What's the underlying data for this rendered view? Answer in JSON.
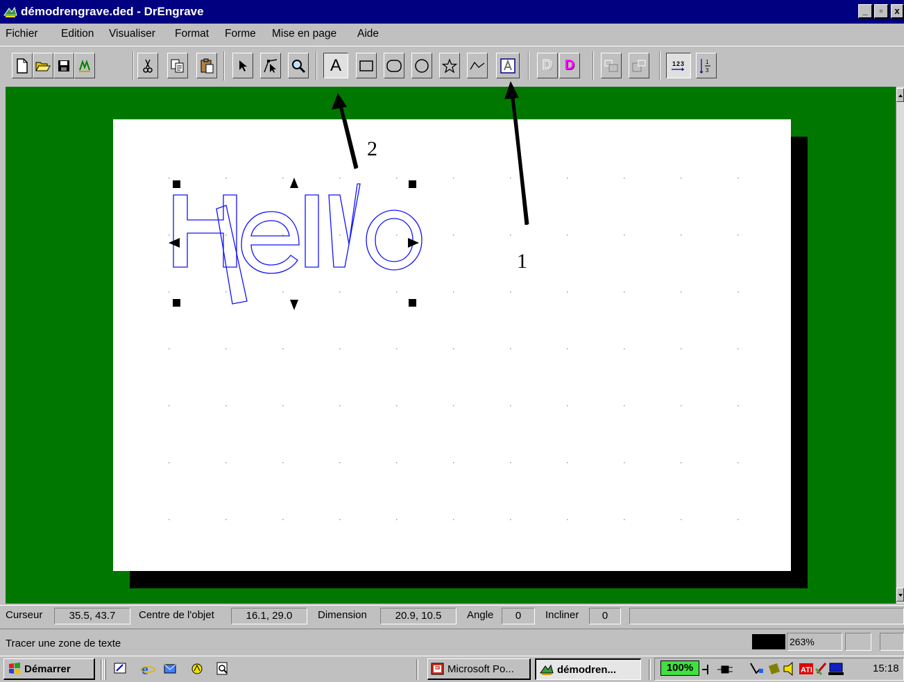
{
  "window": {
    "title": "démodrengrave.ded - DrEngrave",
    "app_icon": "drengrave-app-icon",
    "controls": {
      "minimize": "_",
      "maximize": "▫",
      "close": "x"
    }
  },
  "menu": {
    "items": [
      {
        "id": "fichier",
        "label": "Fichier"
      },
      {
        "id": "edition",
        "label": "Edition"
      },
      {
        "id": "visualiser",
        "label": "Visualiser"
      },
      {
        "id": "format",
        "label": "Format"
      },
      {
        "id": "forme",
        "label": "Forme"
      },
      {
        "id": "mise-en-page",
        "label": "Mise en page"
      },
      {
        "id": "aide",
        "label": "Aide"
      }
    ]
  },
  "toolbar": {
    "buttons": [
      {
        "name": "new-document",
        "icon": "new-document-icon"
      },
      {
        "name": "open",
        "icon": "folder-open-icon"
      },
      {
        "name": "save",
        "icon": "floppy-disk-icon"
      },
      {
        "name": "engrave",
        "icon": "engrave-icon"
      },
      {
        "name": "cut",
        "icon": "scissors-icon"
      },
      {
        "name": "copy",
        "icon": "copy-icon"
      },
      {
        "name": "paste",
        "icon": "clipboard-icon"
      },
      {
        "name": "select",
        "icon": "arrow-cursor-icon"
      },
      {
        "name": "node-edit",
        "icon": "node-edit-icon"
      },
      {
        "name": "zoom",
        "icon": "magnifier-icon"
      },
      {
        "name": "text-tool",
        "icon": "text-a-icon",
        "label": "A"
      },
      {
        "name": "rectangle-tool",
        "icon": "rectangle-icon"
      },
      {
        "name": "rounded-rectangle-tool",
        "icon": "rounded-rectangle-icon"
      },
      {
        "name": "ellipse-tool",
        "icon": "circle-icon"
      },
      {
        "name": "star-tool",
        "icon": "star-icon"
      },
      {
        "name": "polyline-tool",
        "icon": "polyline-icon"
      },
      {
        "name": "text-box-tool",
        "icon": "text-box-icon",
        "label": "A"
      },
      {
        "name": "d-outline",
        "icon": "d-outline-icon",
        "label": "D"
      },
      {
        "name": "d-magenta",
        "icon": "d-magenta-icon",
        "label": "D"
      },
      {
        "name": "align-left",
        "icon": "align-left-icon"
      },
      {
        "name": "align-right",
        "icon": "align-right-icon"
      },
      {
        "name": "numbering",
        "icon": "numbering-123-icon",
        "label": "123"
      },
      {
        "name": "fraction",
        "icon": "fraction-icon"
      }
    ]
  },
  "canvas": {
    "drawn_text": "Hello",
    "annotation_1": "1",
    "annotation_2": "2",
    "colors": {
      "workspace": "#007800",
      "page": "#ffffff",
      "outline": "#0000ff"
    }
  },
  "status": {
    "cursor_label": "Curseur",
    "cursor_value": "35.5, 43.7",
    "center_label": "Centre de l'objet",
    "center_value": "16.1, 29.0",
    "dimension_label": "Dimension",
    "dimension_value": "20.9, 10.5",
    "angle_label": "Angle",
    "angle_value": "0",
    "skew_label": "Incliner",
    "skew_value": "0",
    "hint": "Tracer une zone de texte",
    "zoom": "263%"
  },
  "taskbar": {
    "start_label": "Démarrer",
    "quick_launch": [
      "desktop-icon",
      "internet-explorer-icon",
      "outlook-icon",
      "channels-icon",
      "search-icon"
    ],
    "tasks": [
      {
        "label": "Microsoft Po...",
        "icon": "powerpoint-icon",
        "active": false
      },
      {
        "label": "démodren...",
        "icon": "drengrave-app-icon",
        "active": true
      }
    ],
    "tray_badge": "100%",
    "clock": "15:18"
  }
}
